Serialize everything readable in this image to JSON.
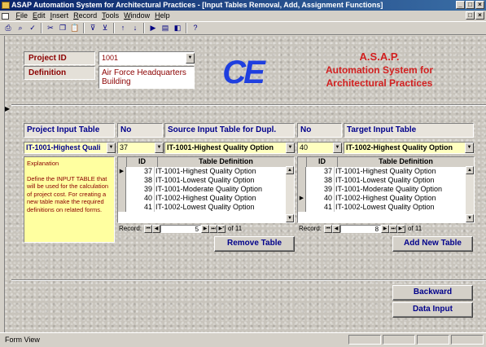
{
  "window": {
    "title": "ASAP Automation System for Architectural Practices - [Input Tables Removal, Add, Assignment Functions]",
    "minimize": "_",
    "maximize": "□",
    "close": "×"
  },
  "menu": [
    {
      "label": "File",
      "underline": "F",
      "rest": "ile"
    },
    {
      "label": "Edit",
      "underline": "E",
      "rest": "dit"
    },
    {
      "label": "Insert",
      "underline": "I",
      "rest": "nsert"
    },
    {
      "label": "Record",
      "underline": "R",
      "rest": "ecord"
    },
    {
      "label": "Tools",
      "underline": "T",
      "rest": "ools"
    },
    {
      "label": "Window",
      "underline": "W",
      "rest": "indow"
    },
    {
      "label": "Help",
      "underline": "H",
      "rest": "elp"
    }
  ],
  "toolbar_icons": [
    "print-icon",
    "print-preview-icon",
    "spelling-icon",
    "cut-icon",
    "copy-icon",
    "paste-icon",
    "filter-by-selection-icon",
    "filter-by-form-icon",
    "sort-ascending-icon",
    "sort-descending-icon",
    "new-record-icon",
    "database-window-icon",
    "new-object-icon",
    "help-icon"
  ],
  "project": {
    "id_label": "Project ID",
    "id_value": "1001",
    "definition_label": "Definition",
    "definition_value": "Air Force Headquarters Building"
  },
  "logo": "CE",
  "app_name_lines": [
    "A.S.A.P.",
    "Automation System for",
    "Architectural Practices"
  ],
  "headers": {
    "project_input_table": "Project Input Table",
    "no_left": "No",
    "source_input_table": "Source Input Table for Dupl.",
    "no_right": "No",
    "target_input_table": "Target Input Table"
  },
  "fields": {
    "project_input_table_value": "IT-1001-Highest Quali",
    "no_left_value": "37",
    "source_value": "IT-1001-Highest Quality Option",
    "no_right_value": "40",
    "target_value": "IT-1002-Highest Quality Option"
  },
  "explanation": {
    "title": "Explanation",
    "text": "Define the INPUT TABLE that will be used for the calculation of project cost. For creating a new table make the required definitions on related forms."
  },
  "grid_headers": {
    "id": "ID",
    "definition": "Table Definition"
  },
  "source_grid": {
    "rows": [
      {
        "id": "37",
        "definition": "IT-1001-Highest Quality Option",
        "current": true
      },
      {
        "id": "38",
        "definition": "IT-1001-Lowest Quality Option",
        "current": false
      },
      {
        "id": "39",
        "definition": "IT-1001-Moderate Quality Option",
        "current": false
      },
      {
        "id": "40",
        "definition": "IT-1002-Highest Quality Option",
        "current": false
      },
      {
        "id": "41",
        "definition": "IT-1002-Lowest Quality Option",
        "current": false
      }
    ],
    "nav": {
      "label": "Record:",
      "current": "5",
      "of": "of 11"
    }
  },
  "target_grid": {
    "rows": [
      {
        "id": "37",
        "definition": "IT-1001-Highest Quality Option",
        "current": false
      },
      {
        "id": "38",
        "definition": "IT-1001-Lowest Quality Option",
        "current": false
      },
      {
        "id": "39",
        "definition": "IT-1001-Moderate Quality Option",
        "current": false
      },
      {
        "id": "40",
        "definition": "IT-1002-Highest Quality Option",
        "current": true
      },
      {
        "id": "41",
        "definition": "IT-1002-Lowest Quality Option",
        "current": false
      }
    ],
    "nav": {
      "label": "Record:",
      "current": "8",
      "of": "of 11"
    }
  },
  "buttons": {
    "remove_table": "Remove Table",
    "add_new_table": "Add New Table",
    "backward": "Backward",
    "data_input": "Data Input"
  },
  "nav_glyphs": {
    "first": "⏮",
    "prev": "◀",
    "next": "▶",
    "last": "⏭",
    "new": "▶*"
  },
  "status": "Form View",
  "colors": {
    "title_bar": "#0a246a",
    "label_red": "#8b0000",
    "header_blue": "#00008b",
    "logo_blue": "#1f3fdf",
    "app_name_red": "#d22020",
    "field_yellow": "#ffffc0"
  }
}
